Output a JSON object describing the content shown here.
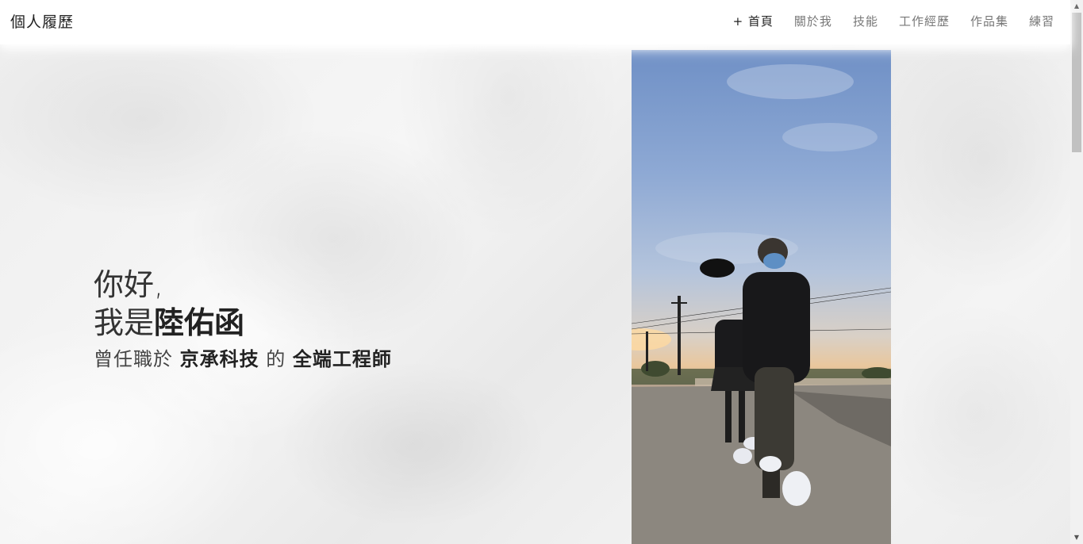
{
  "header": {
    "brand": "個人履歷",
    "nav": [
      {
        "label": "+ 首頁",
        "active": true
      },
      {
        "label": "關於我",
        "active": false
      },
      {
        "label": "技能",
        "active": false
      },
      {
        "label": "工作經歷",
        "active": false
      },
      {
        "label": "作品集",
        "active": false
      },
      {
        "label": "練習",
        "active": false
      }
    ]
  },
  "hero": {
    "greeting": "你好,",
    "name_prefix": "我是",
    "name": "陸佑函",
    "job_prefix": "曾任職於",
    "company": "京承科技",
    "job_connector": "的",
    "role": "全端工程師"
  },
  "colors": {
    "text_dark": "#222222",
    "nav_muted": "#777777",
    "header_bg": "#ffffff"
  }
}
